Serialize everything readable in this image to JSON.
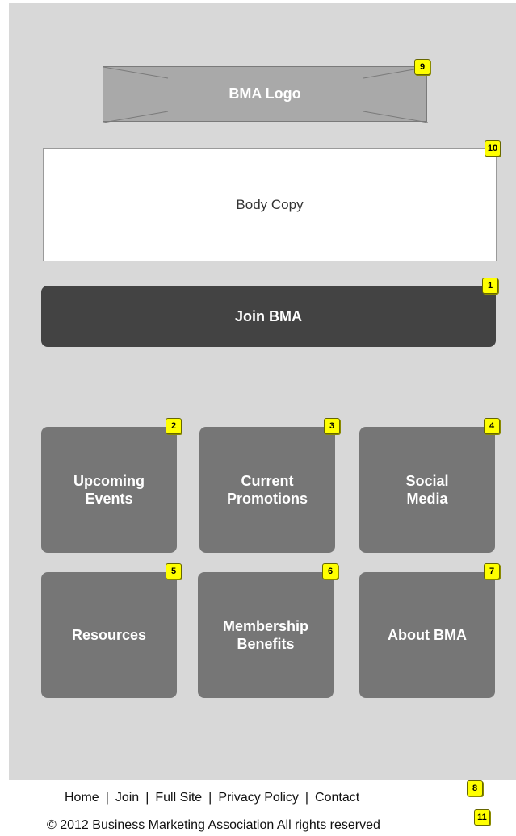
{
  "header": {
    "logo_text": "BMA Logo"
  },
  "content": {
    "body_copy": "Body Copy"
  },
  "join": {
    "label": "Join BMA"
  },
  "tiles": [
    {
      "lines": [
        "Upcoming",
        "Events"
      ]
    },
    {
      "lines": [
        "Current",
        "Promotions"
      ]
    },
    {
      "lines": [
        "Social",
        "Media"
      ]
    },
    {
      "lines": [
        "Resources"
      ]
    },
    {
      "lines": [
        "Membership",
        "Benefits"
      ]
    },
    {
      "lines": [
        "About BMA"
      ]
    }
  ],
  "badges": {
    "logo": "9",
    "body": "10",
    "join": "1",
    "tile_0": "2",
    "tile_1": "3",
    "tile_2": "4",
    "tile_3": "5",
    "tile_4": "6",
    "tile_5": "7",
    "footer_links": "8",
    "copyright": "11"
  },
  "footer": {
    "links": [
      "Home",
      "Join",
      "Full Site",
      "Privacy Policy",
      "Contact"
    ],
    "separator": "|",
    "copyright": "© 2012 Business Marketing Association All rights reserved"
  },
  "colors": {
    "background": "#d8d8d8",
    "logo": "#a9a9a9",
    "join_button": "#434343",
    "tile": "#767676",
    "badge": "#ffff00"
  }
}
